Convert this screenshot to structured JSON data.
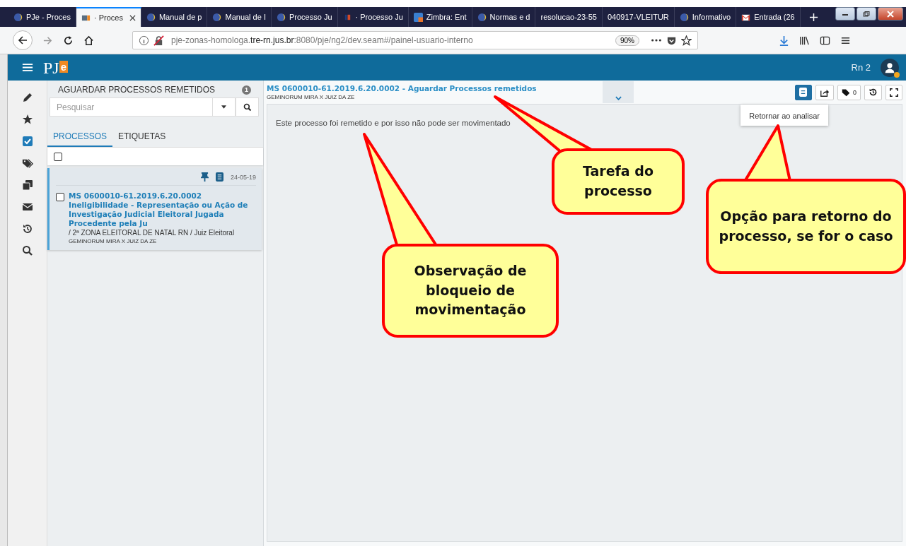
{
  "browser": {
    "tabs": [
      {
        "label": "PJe - Proces",
        "selected": false,
        "kind": "globe"
      },
      {
        "label": "· Proces",
        "selected": true,
        "kind": "pje"
      },
      {
        "label": "Manual de p",
        "selected": false,
        "kind": "globe"
      },
      {
        "label": "Manual de I",
        "selected": false,
        "kind": "globe"
      },
      {
        "label": "Processo Ju",
        "selected": false,
        "kind": "globe"
      },
      {
        "label": "· Processo Ju",
        "selected": false,
        "kind": "tre"
      },
      {
        "label": "Zimbra: Ent",
        "selected": false,
        "kind": "zimbra"
      },
      {
        "label": "Normas e d",
        "selected": false,
        "kind": "globe"
      },
      {
        "label": "resolucao-23-55",
        "selected": false,
        "kind": "plain"
      },
      {
        "label": "040917-VLEITUR",
        "selected": false,
        "kind": "plain"
      },
      {
        "label": "Informativo",
        "selected": false,
        "kind": "globe"
      },
      {
        "label": "Entrada (26",
        "selected": false,
        "kind": "mail"
      }
    ],
    "url": {
      "prefix": "pje-zonas-homologa.",
      "domain": "tre-rn.jus.br",
      "path": ":8080/pje/ng2/dev.seam#/painel-usuario-interno"
    },
    "zoom": "90%"
  },
  "app": {
    "logo": {
      "letters": "PJ",
      "badge": "e"
    },
    "user": "Rn 2"
  },
  "sidebar": {
    "items": [
      {
        "kind": "pencil",
        "selected": false
      },
      {
        "kind": "star",
        "selected": false
      },
      {
        "kind": "check",
        "selected": true
      },
      {
        "kind": "tags",
        "selected": false
      },
      {
        "kind": "copy",
        "selected": false
      },
      {
        "kind": "mail",
        "selected": false
      },
      {
        "kind": "history",
        "selected": false
      },
      {
        "kind": "search",
        "selected": false
      }
    ]
  },
  "task_list": {
    "title": "AGUARDAR PROCESSOS REMETIDOS",
    "count": "1",
    "search": {
      "placeholder": "Pesquisar"
    },
    "tabs": [
      {
        "label": "PROCESSOS",
        "selected": true
      },
      {
        "label": "ETIQUETAS",
        "selected": false
      }
    ],
    "select_all": {
      "checked": false
    },
    "items": [
      {
        "date": "24-05-19",
        "number": "MS 0600010-61.2019.6.20.0002",
        "subject": "Ineligibilidade - Representação ou Ação de Investigação Judicial Eleitoral Jugada Procedente pela Ju",
        "location": "/ 2ª ZONA ELEITORAL DE NATAL RN / Juiz Eleitoral",
        "parties": "GEMINORUM MIRA X JUIZ DA ZE",
        "checked": false,
        "selected": true
      }
    ]
  },
  "process": {
    "title": "MS 0600010-61.2019.6.20.0002 - Aguardar Processos remetidos",
    "parties": "GEMINORUM MIRA X JUIZ DA ZE",
    "toolbar": [
      {
        "kind": "document",
        "selected": true
      },
      {
        "kind": "share",
        "selected": false
      },
      {
        "kind": "tags",
        "count": "0",
        "selected": false
      },
      {
        "kind": "history",
        "selected": false
      },
      {
        "kind": "fullscreen",
        "selected": false
      }
    ],
    "menu": {
      "items": [
        "Retornar ao analisar"
      ]
    },
    "message": "Este processo foi remetido e por isso não pode ser movimentado"
  },
  "callouts": [
    {
      "text": "Tarefa do processo"
    },
    {
      "text": "Opção para retorno do processo, se for o caso"
    },
    {
      "text": "Observação de bloqueio de movimentação"
    }
  ]
}
